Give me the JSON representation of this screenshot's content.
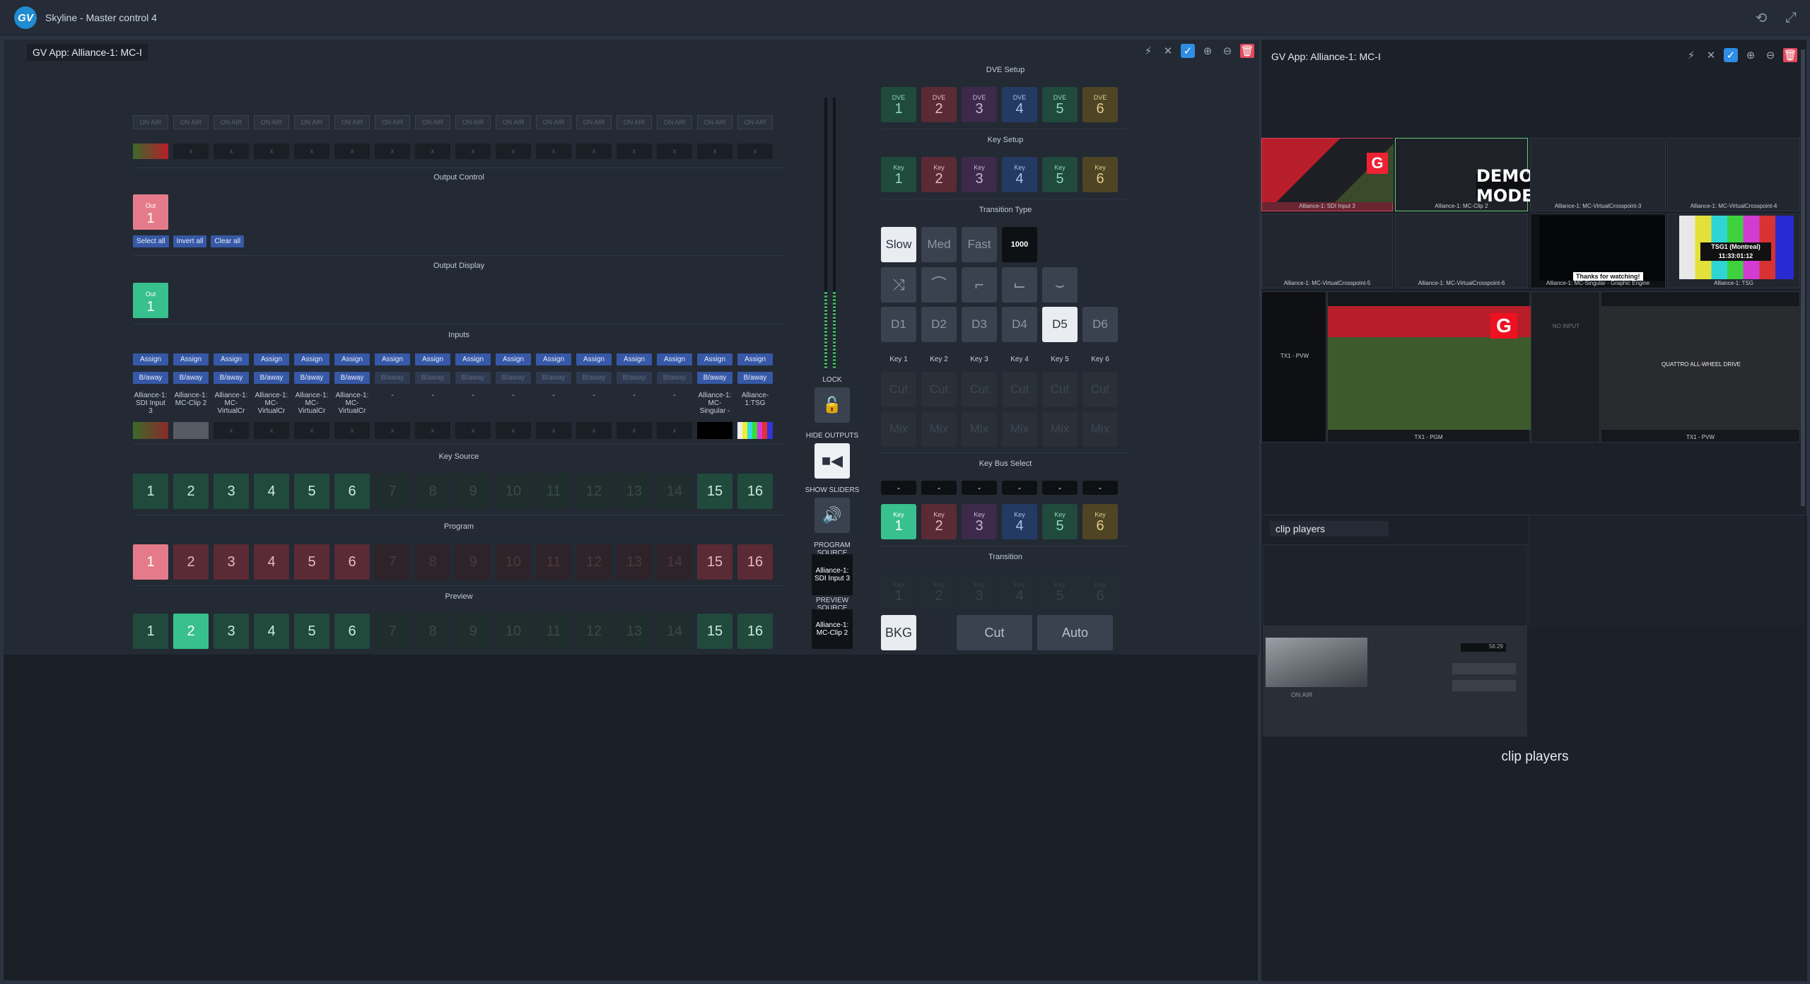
{
  "window": {
    "title": "Skyline - Master control 4"
  },
  "left_panel": {
    "app_title": "GV App: Alliance-1: MC-I",
    "onair_label": "ON AIR",
    "thumb_x": "x",
    "output_control": {
      "title": "Output Control",
      "out_label": "Out",
      "out_num": "1",
      "select_all": "Select all",
      "invert_all": "Invert all",
      "clear_all": "Clear all"
    },
    "output_display": {
      "title": "Output Display",
      "out_label": "Out",
      "out_num": "1"
    },
    "inputs": {
      "title": "Inputs",
      "assign_label": "Assign",
      "baway_label": "B/away",
      "labels": [
        "Alliance-1: SDI Input 3",
        "Alliance-1: MC-Clip 2",
        "Alliance-1: MC-VirtualCr",
        "Alliance-1: MC-VirtualCr",
        "Alliance-1: MC-VirtualCr",
        "Alliance-1: MC-VirtualCr",
        "-",
        "-",
        "-",
        "-",
        "-",
        "-",
        "-",
        "-",
        "Alliance-1: MC-Singular -",
        "Alliance-1:TSG"
      ]
    },
    "key_source": {
      "title": "Key Source",
      "buttons": [
        "1",
        "2",
        "3",
        "4",
        "5",
        "6",
        "7",
        "8",
        "9",
        "10",
        "11",
        "12",
        "13",
        "14",
        "15",
        "16"
      ]
    },
    "program": {
      "title": "Program",
      "buttons": [
        "1",
        "2",
        "3",
        "4",
        "5",
        "6",
        "7",
        "8",
        "9",
        "10",
        "11",
        "12",
        "13",
        "14",
        "15",
        "16"
      ]
    },
    "preview": {
      "title": "Preview",
      "buttons": [
        "1",
        "2",
        "3",
        "4",
        "5",
        "6",
        "7",
        "8",
        "9",
        "10",
        "11",
        "12",
        "13",
        "14",
        "15",
        "16"
      ]
    },
    "middle": {
      "lock": "LOCK",
      "hide_outputs": "HIDE OUTPUTS",
      "show_sliders": "SHOW SLIDERS",
      "program_source_label": "PROGRAM SOURCE",
      "program_source": "Alliance-1: SDI Input 3",
      "preview_source_label": "PREVIEW SOURCE",
      "preview_source": "Alliance-1: MC-Clip 2"
    },
    "dve_setup": {
      "title": "DVE Setup",
      "label": "DVE",
      "buttons": [
        "1",
        "2",
        "3",
        "4",
        "5",
        "6"
      ]
    },
    "key_setup": {
      "title": "Key Setup",
      "label": "Key",
      "buttons": [
        "1",
        "2",
        "3",
        "4",
        "5",
        "6"
      ]
    },
    "transition_type": {
      "title": "Transition Type",
      "speeds": [
        "Slow",
        "Med",
        "Fast"
      ],
      "rate": "1000",
      "dlist": [
        "D1",
        "D2",
        "D3",
        "D4",
        "D5",
        "D6"
      ],
      "keys": [
        "Key 1",
        "Key 2",
        "Key 3",
        "Key 4",
        "Key 5",
        "Key 6"
      ],
      "cut": "Cut",
      "mix": "Mix"
    },
    "key_bus_select": {
      "title": "Key Bus Select",
      "dash": "-",
      "label": "Key",
      "buttons": [
        "1",
        "2",
        "3",
        "4",
        "5",
        "6"
      ]
    },
    "transition": {
      "title": "Transition",
      "label": "Key",
      "buttons": [
        "1",
        "2",
        "3",
        "4",
        "5",
        "6"
      ],
      "bkg": "BKG",
      "cut": "Cut",
      "auto": "Auto"
    }
  },
  "right_panel": {
    "app_title": "GV App: Alliance-1: MC-I",
    "demo_mode": "DEMO MODE",
    "tiles": [
      "Alliance-1: SDI Input 3",
      "Alliance-1: MC-Clip 2",
      "Alliance-1: MC-VirtualCrosspoint-3",
      "Alliance-1: MC-VirtualCrosspoint-4",
      "Alliance-1: MC-VirtualCrosspoint-5",
      "Alliance-1: MC-VirtualCrosspoint-6",
      "Alliance-1: MC-Singular - Graphic Engine",
      "Alliance-1: TSG"
    ],
    "thanks": "Thanks for watching!",
    "tsg_text": "TSG1 (Montreal)",
    "tsg_time": "11:33:01:12",
    "tx_pvw_small": "TX1 - PVW",
    "tx_pgm": "TX1 - PGM",
    "tx_pvw": "TX1 - PVW",
    "no_input": "NO INPUT",
    "quattro": "QUATTRO ALL-WHEEL DRIVE"
  },
  "clip_panel": {
    "search_value": "clip players",
    "caption": "clip players",
    "onair": "ON AIR",
    "timecode": "56:29"
  }
}
